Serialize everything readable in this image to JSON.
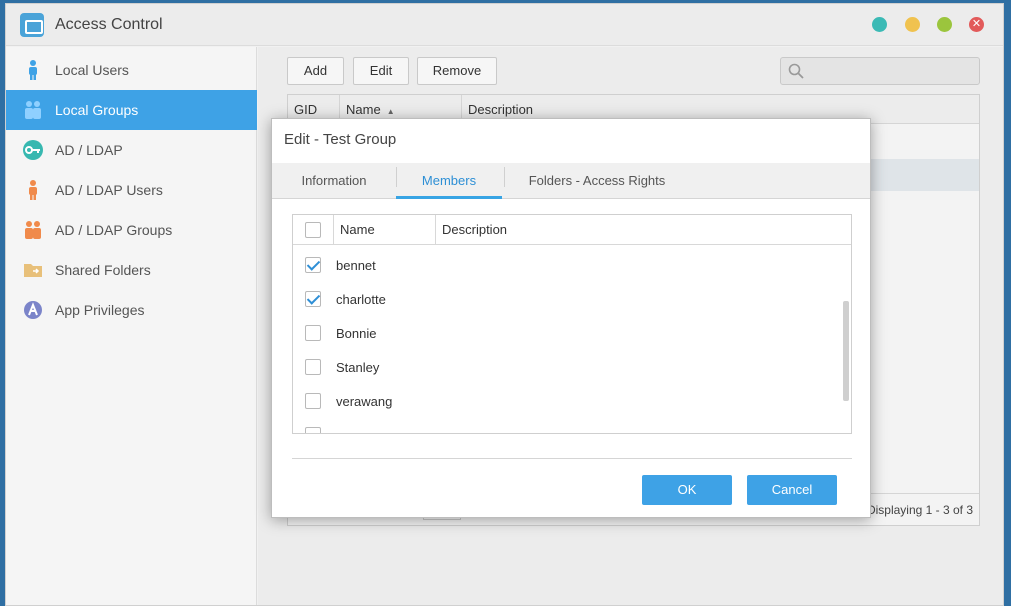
{
  "app": {
    "title": "Access Control"
  },
  "sidebar": {
    "items": [
      {
        "label": "Local Users",
        "icon": "user-icon",
        "active": false
      },
      {
        "label": "Local Groups",
        "icon": "group-icon",
        "active": true
      },
      {
        "label": "AD / LDAP",
        "icon": "key-icon",
        "active": false
      },
      {
        "label": "AD / LDAP Users",
        "icon": "user-icon",
        "active": false
      },
      {
        "label": "AD / LDAP Groups",
        "icon": "group-icon",
        "active": false
      },
      {
        "label": "Shared Folders",
        "icon": "folder-icon",
        "active": false
      },
      {
        "label": "App Privileges",
        "icon": "app-icon",
        "active": false
      }
    ]
  },
  "toolbar": {
    "add_label": "Add",
    "edit_label": "Edit",
    "remove_label": "Remove"
  },
  "search": {
    "placeholder": ""
  },
  "grid": {
    "columns": [
      "GID",
      "Name",
      "Description"
    ],
    "footer": "Displaying 1 - 3 of 3"
  },
  "dialog": {
    "title": "Edit - Test Group",
    "tabs": [
      "Information",
      "Members",
      "Folders - Access Rights"
    ],
    "active_tab": "Members",
    "members": {
      "columns": [
        "Name",
        "Description"
      ],
      "rows": [
        {
          "name": "bennet",
          "checked": true
        },
        {
          "name": "charlotte",
          "checked": true
        },
        {
          "name": "Bonnie",
          "checked": false
        },
        {
          "name": "Stanley",
          "checked": false
        },
        {
          "name": "verawang",
          "checked": false
        }
      ]
    },
    "ok_label": "OK",
    "cancel_label": "Cancel"
  },
  "colors": {
    "accent": "#3ea2e6"
  }
}
